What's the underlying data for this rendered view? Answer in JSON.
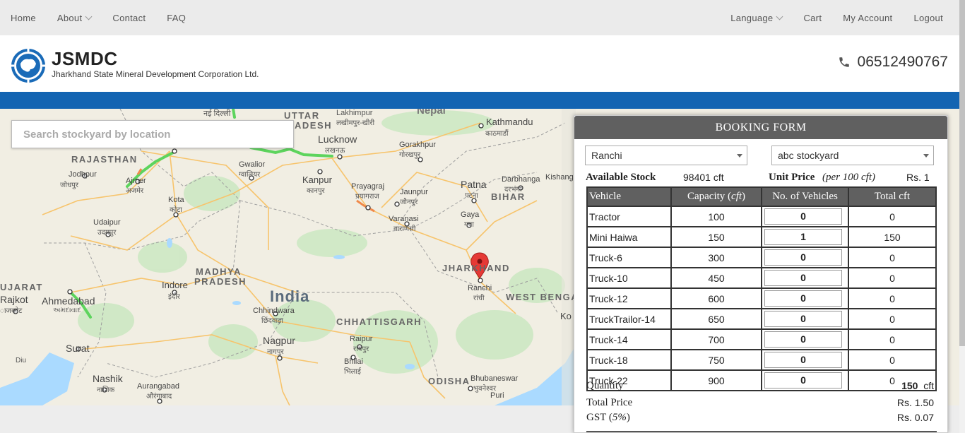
{
  "topnav": {
    "left": [
      "Home",
      "About",
      "Contact",
      "FAQ"
    ],
    "right": [
      "Language",
      "Cart",
      "My Account",
      "Logout"
    ]
  },
  "brand": {
    "name": "JSMDC",
    "full_name": "Jharkhand State Mineral Development Corporation Ltd."
  },
  "phone": "06512490767",
  "colors": {
    "accent_blue": "#1364b2",
    "header_gray": "#606060",
    "route_green": "#5dd45d"
  },
  "search": {
    "placeholder": "Search stockyard by location"
  },
  "map": {
    "labels": {
      "uttar": "UTTAR",
      "pradesh_partial": "ADESH",
      "lucknow": "Lucknow",
      "lucknow_hi": "लखनऊ",
      "lakhimpur": "Lakhimpur",
      "lakhimpur_hi": "लखीमपुर-खीरी",
      "nepal": "Nepal",
      "kathmandu": "Kathmandu",
      "kathmandu_hi": "काठमाडौं",
      "delhi_hi": "नई दिल्ली",
      "rajasthan": "RAJASTHAN",
      "jodhpur": "Jodhpur",
      "jodhpur_hi": "जोधपुर",
      "ajmer": "Ajmer",
      "ajmer_hi": "अजमेर",
      "gwalior": "Gwalior",
      "gwalior_hi": "ग्वालियर",
      "kanpur": "Kanpur",
      "kanpur_hi": "कानपुर",
      "gorakhpur": "Gorakhpur",
      "gorakhpur_hi": "गोरखपुर",
      "prayagraj": "Prayagraj",
      "prayagraj_hi": "प्रयागराज",
      "jaunpur": "Jaunpur",
      "jaunpur_hi": "जौनपुर",
      "varanasi": "Varanasi",
      "varanasi_hi": "वाराणसी",
      "patna": "Patna",
      "patna_hi": "पटना",
      "darbhanga": "Darbhanga",
      "darbhanga_hi": "दरभंगा",
      "bihar": "BIHAR",
      "kishanganj": "Kishang",
      "gaya": "Gaya",
      "gaya_hi": "गया",
      "kota": "Kota",
      "kota_hi": "कोटा",
      "udaipur": "Udaipur",
      "udaipur_hi": "उदयपुर",
      "madhya": "MADHYA",
      "pradesh": "PRADESH",
      "india": "India",
      "indore": "Indore",
      "indore_hi": "इंदौर",
      "jharkhand": "JHARKHAND",
      "ranchi": "Ranchi",
      "ranchi_hi": "रांची",
      "west_bengal": "WEST BENGA",
      "gujarat": "UJARAT",
      "rajkot": "Rajkot",
      "rajkot_hi": "ाजकोट",
      "ahmedabad": "Ahmedabad",
      "ahmedabad_hi": "અમદાવાદ",
      "chhindwara": "Chhindwara",
      "chhindwara_hi": "छिंदवाड़ा",
      "chhattisgarh": "CHHATTISGARH",
      "raipur": "Raipur",
      "raipur_hi": "रायपुर",
      "bhilai": "Bhilai",
      "bhilai_hi": "भिलाई",
      "surat": "Surat",
      "nagpur": "Nagpur",
      "nagpur_hi": "नागपुर",
      "diu": "Diu",
      "nashik": "Nashik",
      "nashik_hi": "नाशिक",
      "aurangabad": "Aurangabad",
      "aurangabad_hi": "औरंगाबाद",
      "odisha": "ODISHA",
      "bhubaneswar": "Bhubaneswar",
      "bhubaneswar_hi": "भुवनेश्वर",
      "puri": "Puri",
      "kol_partial": "Ko"
    }
  },
  "form": {
    "title": "BOOKING FORM",
    "district": "Ranchi",
    "stockyard": "abc stockyard",
    "available_stock_label": "Available Stock",
    "available_stock_value": "98401 cft",
    "unit_price_label": "Unit Price",
    "unit_price_note": "(per 100 cft)",
    "unit_price_value": "Rs. 1",
    "columns": {
      "vehicle": "Vehicle",
      "capacity": "Capacity (",
      "capacity_unit": "cft",
      "capacity_close": ")",
      "count": "No. of Vehicles",
      "total": "Total cft"
    },
    "rows": [
      {
        "vehicle": "Tractor",
        "capacity": "100",
        "count": "0",
        "total": "0"
      },
      {
        "vehicle": "Mini Haiwa",
        "capacity": "150",
        "count": "1",
        "total": "150"
      },
      {
        "vehicle": "Truck-6",
        "capacity": "300",
        "count": "0",
        "total": "0"
      },
      {
        "vehicle": "Truck-10",
        "capacity": "450",
        "count": "0",
        "total": "0"
      },
      {
        "vehicle": "Truck-12",
        "capacity": "600",
        "count": "0",
        "total": "0"
      },
      {
        "vehicle": "TruckTrailor-14",
        "capacity": "650",
        "count": "0",
        "total": "0"
      },
      {
        "vehicle": "Truck-14",
        "capacity": "700",
        "count": "0",
        "total": "0"
      },
      {
        "vehicle": "Truck-18",
        "capacity": "750",
        "count": "0",
        "total": "0"
      },
      {
        "vehicle": "Truck-22",
        "capacity": "900",
        "count": "0",
        "total": "0"
      }
    ],
    "quantity_label": "Quantity",
    "quantity_value": "150",
    "quantity_unit": "cft",
    "total_price_label": "Total Price",
    "total_price_value": "Rs. 1.50",
    "gst_label": "GST (",
    "gst_rate": "5%",
    "gst_close": ")",
    "gst_value": "Rs. 0.07"
  }
}
